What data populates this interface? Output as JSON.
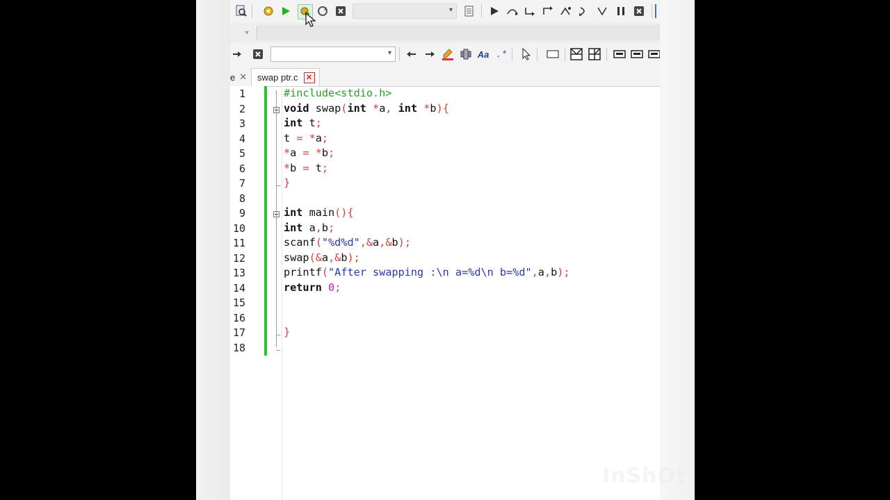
{
  "editor": {
    "tab_prev_label": "e",
    "tab_prev_close": "✕",
    "active_tab": "swap ptr.c",
    "active_tab_close": "✕"
  },
  "lines": [
    {
      "n": "1",
      "tokens": [
        {
          "t": "#include<stdio.h>",
          "c": "pp"
        }
      ]
    },
    {
      "n": "2",
      "tokens": [
        {
          "t": "void",
          "c": "kw"
        },
        {
          "t": " swap",
          "c": "nm"
        },
        {
          "t": "(",
          "c": "op"
        },
        {
          "t": "int",
          "c": "kw"
        },
        {
          "t": " ",
          "c": "nm"
        },
        {
          "t": "*",
          "c": "op"
        },
        {
          "t": "a",
          "c": "nm"
        },
        {
          "t": ", ",
          "c": "op"
        },
        {
          "t": "int",
          "c": "kw"
        },
        {
          "t": " ",
          "c": "nm"
        },
        {
          "t": "*",
          "c": "op"
        },
        {
          "t": "b",
          "c": "nm"
        },
        {
          "t": "){",
          "c": "op"
        }
      ]
    },
    {
      "n": "3",
      "tokens": [
        {
          "t": "int",
          "c": "kw"
        },
        {
          "t": " t",
          "c": "nm"
        },
        {
          "t": ";",
          "c": "op"
        }
      ]
    },
    {
      "n": "4",
      "tokens": [
        {
          "t": "t ",
          "c": "nm"
        },
        {
          "t": "= *",
          "c": "op"
        },
        {
          "t": "a",
          "c": "nm"
        },
        {
          "t": ";",
          "c": "op"
        }
      ]
    },
    {
      "n": "5",
      "tokens": [
        {
          "t": "*",
          "c": "op"
        },
        {
          "t": "a ",
          "c": "nm"
        },
        {
          "t": "= *",
          "c": "op"
        },
        {
          "t": "b",
          "c": "nm"
        },
        {
          "t": ";",
          "c": "op"
        }
      ]
    },
    {
      "n": "6",
      "tokens": [
        {
          "t": "*",
          "c": "op"
        },
        {
          "t": "b ",
          "c": "nm"
        },
        {
          "t": "= ",
          "c": "op"
        },
        {
          "t": "t",
          "c": "nm"
        },
        {
          "t": ";",
          "c": "op"
        }
      ]
    },
    {
      "n": "7",
      "tokens": [
        {
          "t": "}",
          "c": "op"
        }
      ]
    },
    {
      "n": "8",
      "tokens": []
    },
    {
      "n": "9",
      "tokens": [
        {
          "t": "int",
          "c": "kw"
        },
        {
          "t": " main",
          "c": "nm"
        },
        {
          "t": "(){",
          "c": "op"
        }
      ]
    },
    {
      "n": "10",
      "tokens": [
        {
          "t": "int",
          "c": "kw"
        },
        {
          "t": " a",
          "c": "nm"
        },
        {
          "t": ",",
          "c": "op"
        },
        {
          "t": "b",
          "c": "nm"
        },
        {
          "t": ";",
          "c": "op"
        }
      ]
    },
    {
      "n": "11",
      "tokens": [
        {
          "t": "scanf",
          "c": "nm"
        },
        {
          "t": "(",
          "c": "op"
        },
        {
          "t": "\"%d%d\"",
          "c": "st"
        },
        {
          "t": ",&",
          "c": "op"
        },
        {
          "t": "a",
          "c": "nm"
        },
        {
          "t": ",&",
          "c": "op"
        },
        {
          "t": "b",
          "c": "nm"
        },
        {
          "t": ");",
          "c": "op"
        }
      ]
    },
    {
      "n": "12",
      "tokens": [
        {
          "t": "swap",
          "c": "nm"
        },
        {
          "t": "(&",
          "c": "op"
        },
        {
          "t": "a",
          "c": "nm"
        },
        {
          "t": ",&",
          "c": "op"
        },
        {
          "t": "b",
          "c": "nm"
        },
        {
          "t": ");",
          "c": "op"
        }
      ]
    },
    {
      "n": "13",
      "tokens": [
        {
          "t": "printf",
          "c": "nm"
        },
        {
          "t": "(",
          "c": "op"
        },
        {
          "t": "\"After swapping :\\n a=%d\\n b=%d\"",
          "c": "st"
        },
        {
          "t": ",",
          "c": "op"
        },
        {
          "t": "a",
          "c": "nm"
        },
        {
          "t": ",",
          "c": "op"
        },
        {
          "t": "b",
          "c": "nm"
        },
        {
          "t": ");",
          "c": "op"
        }
      ]
    },
    {
      "n": "14",
      "tokens": [
        {
          "t": "return",
          "c": "kw"
        },
        {
          "t": " ",
          "c": "nm"
        },
        {
          "t": "0",
          "c": "nu"
        },
        {
          "t": ";",
          "c": "op"
        }
      ]
    },
    {
      "n": "15",
      "tokens": []
    },
    {
      "n": "16",
      "tokens": []
    },
    {
      "n": "17",
      "tokens": [
        {
          "t": "}",
          "c": "op"
        }
      ]
    },
    {
      "n": "18",
      "tokens": []
    }
  ],
  "icons": {
    "toolbar1": [
      "search-file-icon",
      "compile-gear-icon",
      "run-icon",
      "compile-run-icon",
      "rebuild-icon",
      "stop-icon",
      "compiler-dropdown",
      "settings-icon",
      "debug-run-icon",
      "step-over-icon",
      "step-into-icon",
      "step-out-icon",
      "run-to-cursor-icon",
      "next-line-icon",
      "skip-icon",
      "pause-icon",
      "abort-icon"
    ],
    "toolbar3": [
      "goto-icon",
      "stop-search-icon",
      "search-box",
      "back-icon",
      "forward-icon",
      "highlight-icon",
      "bookmark-icon",
      "match-case-icon",
      "regex-icon",
      "pointer-icon",
      "rectangle-icon",
      "grid-icon-1",
      "grid-icon-2",
      "layout-icon-1",
      "layout-icon-2",
      "layout-icon-3"
    ]
  },
  "colors": {
    "gutter_change_bar": "#2fc12f",
    "preprocessor": "#2aa02a",
    "operator": "#d04040",
    "string": "#2a38a8",
    "number": "#c020c0",
    "close_button": "#c03030"
  },
  "watermark": "InShOt"
}
